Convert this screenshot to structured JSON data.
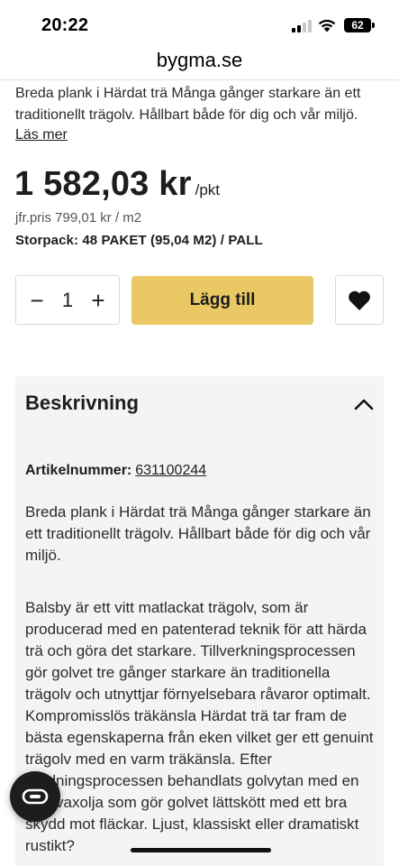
{
  "status_bar": {
    "time": "20:22",
    "battery": "62"
  },
  "browser": {
    "url": "bygma.se"
  },
  "product": {
    "short_description": "Breda plank i Härdat trä Många gånger starkare än ett traditionellt trägolv. Hållbart både för dig och vår miljö.",
    "read_more": "Läs mer",
    "price": "1 582,03 kr",
    "price_unit": "/pkt",
    "compare_price": "jfr.pris 799,01 kr / m2",
    "storpack": "Storpack: 48 PAKET (95,04 M2) / PALL",
    "quantity": "1",
    "minus": "−",
    "plus": "+",
    "add_to_cart": "Lägg till"
  },
  "description": {
    "title": "Beskrivning",
    "article_label": "Artikelnummer:",
    "article_number": "631100244",
    "paragraph1": "Breda plank i Härdat trä Många gånger starkare än ett traditionellt trägolv. Hållbart både för dig och vår miljö.",
    "paragraph2": "Balsby är ett vitt matlackat trägolv, som är producerad med en patenterad teknik för att härda trä och göra det starkare. Tillverkningsprocessen gör golvet tre gånger starkare än traditionella trägolv och utnyttjar förnyelsebara råvaror optimalt. Kompromisslös träkänsla Härdat trä tar fram de bästa egenskaperna från eken vilket ger ett genuint trägolv med en varm träkänsla. Efter härdningsprocessen behandlats golvytan med en hårdvaxolja som gör golvet lättskött med ett bra skydd mot fläckar. Ljust, klassiskt eller dramatiskt rustikt?"
  },
  "icons": {
    "signal": "cellular-signal-icon",
    "wifi": "wifi-icon",
    "battery": "battery-icon",
    "heart": "heart-icon",
    "chevron": "chevron-up-icon",
    "chat": "chat-icon"
  },
  "colors": {
    "accent": "#eac864",
    "panel": "#f4f4f4",
    "text": "#1d1d1f"
  }
}
